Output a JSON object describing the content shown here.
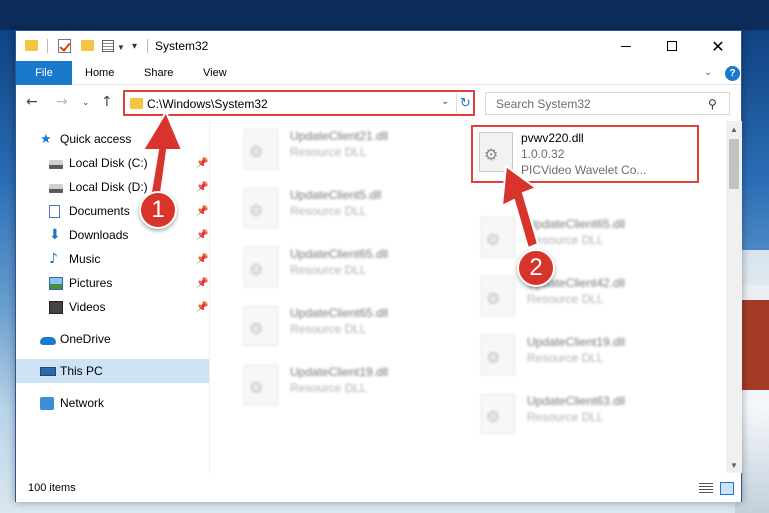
{
  "window": {
    "title": "System32"
  },
  "ribbon": {
    "tabs": [
      "File",
      "Home",
      "Share",
      "View"
    ]
  },
  "address": {
    "path": "C:\\Windows\\System32"
  },
  "search": {
    "placeholder": "Search System32"
  },
  "nav": {
    "items": [
      {
        "label": "Quick access",
        "icon": "star-icon"
      },
      {
        "label": "Local Disk (C:)",
        "icon": "disk-icon"
      },
      {
        "label": "Local Disk (D:)",
        "icon": "disk-icon"
      },
      {
        "label": "Documents",
        "icon": "documents-icon"
      },
      {
        "label": "Downloads",
        "icon": "download-icon"
      },
      {
        "label": "Music",
        "icon": "music-icon"
      },
      {
        "label": "Pictures",
        "icon": "pictures-icon"
      },
      {
        "label": "Videos",
        "icon": "videos-icon"
      },
      {
        "label": "OneDrive",
        "icon": "onedrive-icon"
      },
      {
        "label": "This PC",
        "icon": "pc-icon"
      },
      {
        "label": "Network",
        "icon": "network-icon"
      }
    ]
  },
  "files": {
    "left": [
      {
        "name": "UpdateClient21.dll",
        "type": "Resource DLL"
      },
      {
        "name": "UpdateClient5.dll",
        "type": "Resource DLL"
      },
      {
        "name": "UpdateClient65.dll",
        "type": "Resource DLL"
      },
      {
        "name": "UpdateClient65.dll",
        "type": "Resource DLL"
      },
      {
        "name": "UpdateClient19.dll",
        "type": "Resource DLL"
      }
    ],
    "highlighted": {
      "name": "pvwv220.dll",
      "version": "1.0.0.32",
      "description": "PICVideo Wavelet Co..."
    },
    "right": [
      {
        "name": "UpdateClient65.dll",
        "type": "Resource DLL"
      },
      {
        "name": "UpdateClient42.dll",
        "type": "Resource DLL"
      },
      {
        "name": "UpdateClient19.dll",
        "type": "Resource DLL"
      },
      {
        "name": "UpdateClient63.dll",
        "type": "Resource DLL"
      }
    ]
  },
  "status": {
    "item_count": "100 items"
  },
  "annotations": {
    "step1": "1",
    "step2": "2"
  },
  "colors": {
    "accent": "#1979ca",
    "highlight": "#e0403a",
    "badge": "#d9342b"
  }
}
